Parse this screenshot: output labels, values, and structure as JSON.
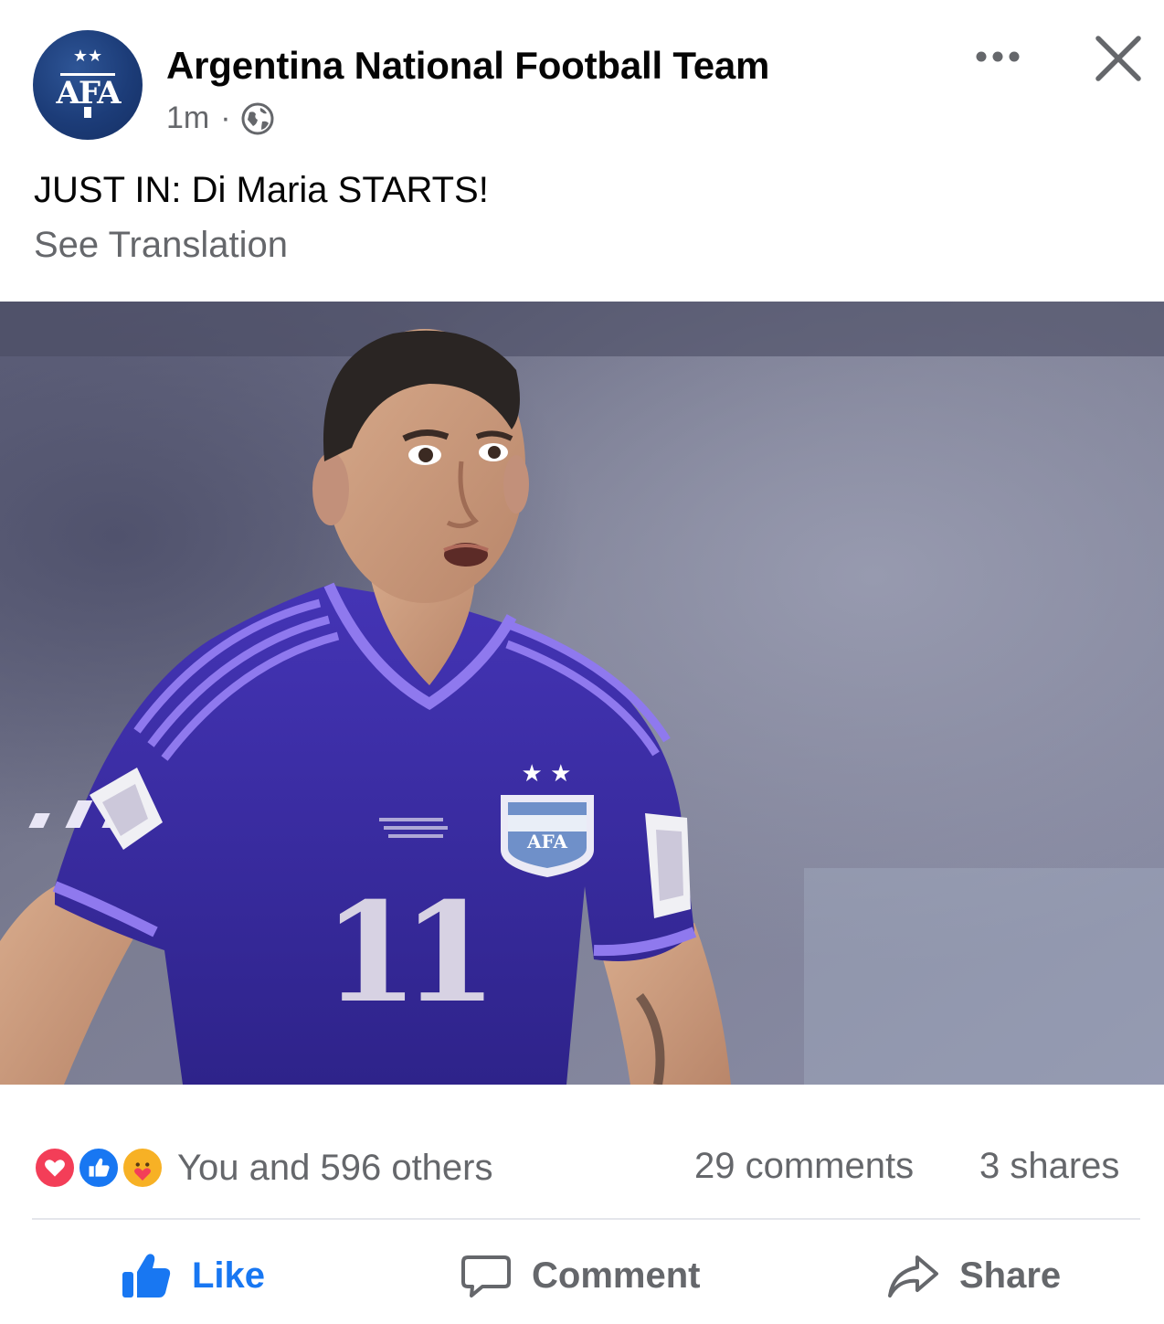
{
  "post": {
    "page_name": "Argentina National Football Team",
    "time": "1m",
    "separator": "·",
    "audience_icon": "globe-icon",
    "text": "JUST IN: Di Maria STARTS!",
    "see_translation": "See Translation",
    "avatar": {
      "logo_text": "AFA",
      "stars": "★★",
      "color": "#1c3c78"
    },
    "photo": {
      "jersey_number": "11",
      "crest_text": "AFA",
      "jersey_color": "#3a2f9e"
    }
  },
  "header": {
    "more_icon": "more-horizontal-icon",
    "close_icon": "close-icon"
  },
  "stats": {
    "reactions": [
      "love-reaction-icon",
      "like-reaction-icon",
      "care-reaction-icon"
    ],
    "reaction_text": "You and 596 others",
    "comments": "29 comments",
    "shares": "3 shares"
  },
  "actions": {
    "like_label": "Like",
    "comment_label": "Comment",
    "share_label": "Share",
    "like_color": "#1877f2",
    "muted_color": "#65676b"
  }
}
